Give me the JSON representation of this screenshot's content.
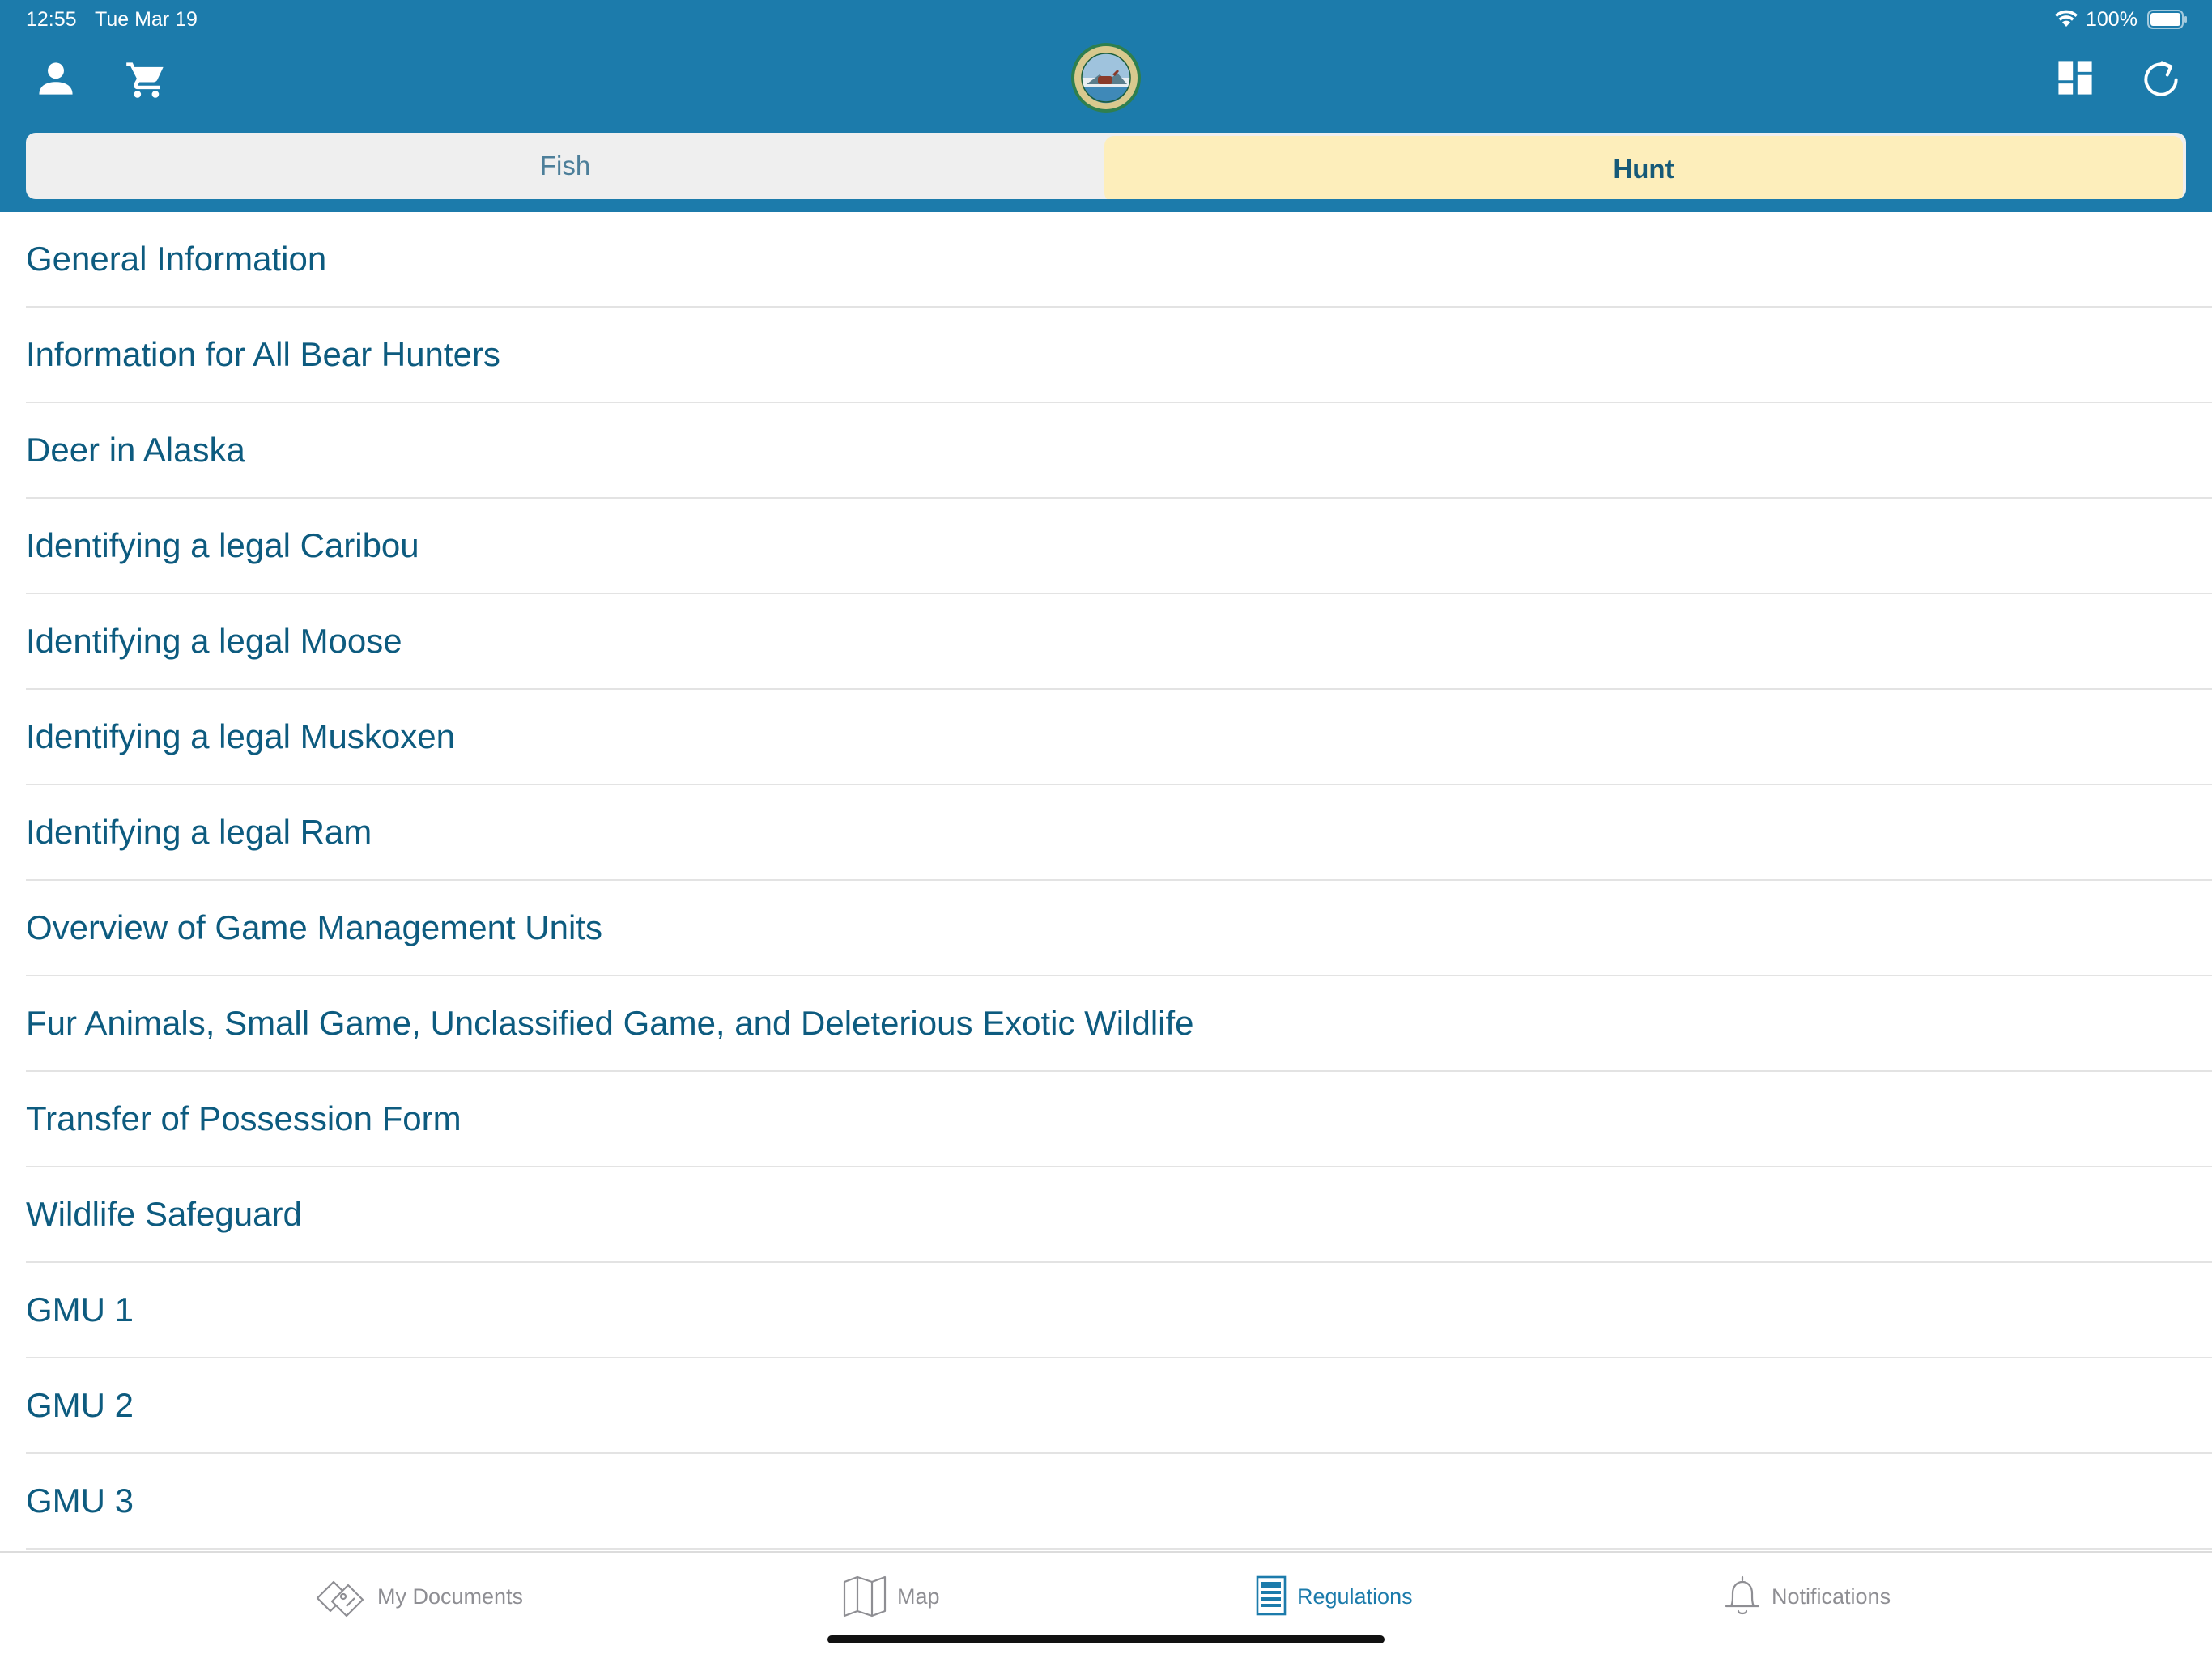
{
  "status_bar": {
    "time": "12:55",
    "date": "Tue Mar 19",
    "battery": "100%"
  },
  "header": {
    "icons": [
      "account-icon",
      "cart-icon",
      "dashboard-icon",
      "refresh-icon"
    ],
    "logo": "alaska-seal-logo"
  },
  "segments": {
    "fish": "Fish",
    "hunt": "Hunt",
    "selected": "Hunt"
  },
  "regulations": [
    "General Information",
    "Information for All Bear Hunters",
    "Deer in Alaska",
    "Identifying a legal Caribou",
    "Identifying a legal Moose",
    "Identifying a legal Muskoxen",
    "Identifying a legal Ram",
    "Overview of Game Management Units",
    "Fur Animals, Small Game, Unclassified Game, and Deleterious Exotic Wildlife",
    "Transfer of Possession Form",
    "Wildlife Safeguard",
    "GMU 1",
    "GMU 2",
    "GMU 3"
  ],
  "tabs": {
    "documents": "My Documents",
    "map": "Map",
    "regulations": "Regulations",
    "notifications": "Notifications",
    "active": "Regulations"
  },
  "colors": {
    "header_blue": "#1c7bab",
    "link_text": "#0d5b7f",
    "selected_segment": "#fdeebb",
    "unselected_segment": "#efefef",
    "tab_inactive": "#8e8e93"
  }
}
